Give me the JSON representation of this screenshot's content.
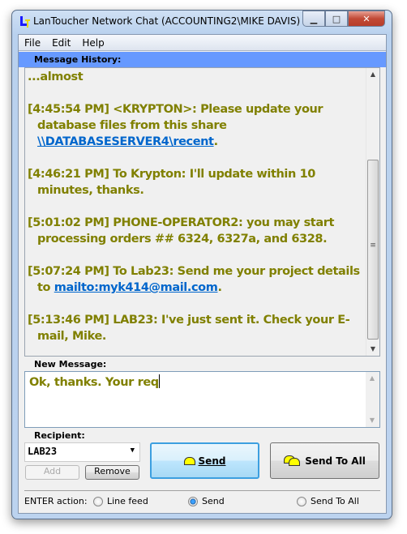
{
  "window": {
    "title": "LanToucher Network Chat (ACCOUNTING2\\MIKE DAVIS)"
  },
  "menu": [
    "File",
    "Edit",
    "Help"
  ],
  "history": {
    "label": "Message History:",
    "top_line": "...almost",
    "messages": [
      {
        "text": "[4:45:54 PM] <KRYPTON>: Please update your database files from this share ",
        "link": "\\\\DATABASESERVER4\\recent",
        "after": "."
      },
      {
        "text": "[4:46:21 PM] To Krypton: I'll update within 10 minutes, thanks."
      },
      {
        "text": "[5:01:02 PM] PHONE-OPERATOR2: you may start processing orders ## 6324, 6327a, and 6328."
      },
      {
        "text": "[5:07:24 PM] To Lab23: Send me your project details to ",
        "link": "mailto:myk414@mail.com",
        "after": "."
      },
      {
        "text": "[5:13:46 PM] LAB23: I've just sent it. Check your E-mail, Mike."
      }
    ]
  },
  "new_message": {
    "label": "New Message:",
    "value": "Ok, thanks. Your req"
  },
  "recipient": {
    "label": "Recipient:",
    "value": "LAB23",
    "add": "Add",
    "remove": "Remove"
  },
  "buttons": {
    "send": "Send",
    "send_all": "Send To All"
  },
  "enter_action": {
    "label": "ENTER action:",
    "options": [
      "Line feed",
      "Send",
      "Send To All"
    ],
    "selected": "Send"
  },
  "colors": {
    "message_text": "#808000",
    "link": "#0066cc",
    "history_bar": "#6699ff"
  }
}
